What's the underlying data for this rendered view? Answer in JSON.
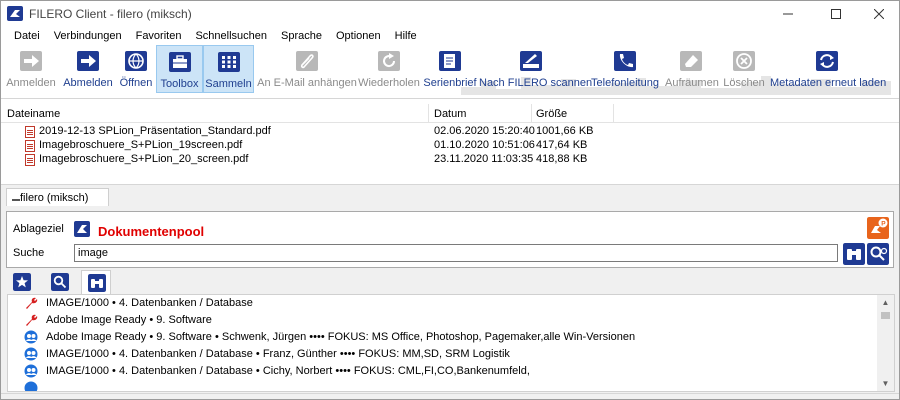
{
  "window": {
    "title": "FILERO Client  -  filero (miksch)"
  },
  "menu": [
    "Datei",
    "Verbindungen",
    "Favoriten",
    "Schnellsuchen",
    "Sprache",
    "Optionen",
    "Hilfe"
  ],
  "toolbar": [
    {
      "label": "Anmelden",
      "icon": "login-icon",
      "disabled": true
    },
    {
      "label": "Abmelden",
      "icon": "logout-icon",
      "disabled": false
    },
    {
      "label": "Öffnen",
      "icon": "globe-icon",
      "disabled": false
    },
    {
      "label": "Toolbox",
      "icon": "toolbox-icon",
      "disabled": false,
      "selected": true
    },
    {
      "label": "Sammeln",
      "icon": "grid-icon",
      "disabled": false,
      "selected": true
    },
    {
      "label": "An E-Mail anhängen",
      "icon": "email-attach-icon",
      "disabled": true
    },
    {
      "label": "Wiederholen",
      "icon": "repeat-icon",
      "disabled": true
    },
    {
      "label": "Serienbrief",
      "icon": "letter-icon",
      "disabled": false
    },
    {
      "label": "Nach FILERO scannen",
      "icon": "scanner-icon",
      "disabled": false
    },
    {
      "label": "Telefonleitung",
      "icon": "phone-icon",
      "disabled": false
    },
    {
      "label": "Aufräumen",
      "icon": "eraser-icon",
      "disabled": true
    },
    {
      "label": "Löschen",
      "icon": "delete-icon",
      "disabled": true
    },
    {
      "label": "Metadaten erneut laden",
      "icon": "reload-icon",
      "disabled": false
    }
  ],
  "files": {
    "headers": {
      "name": "Dateiname",
      "date": "Datum",
      "size": "Größe"
    },
    "rows": [
      {
        "name": "2019-12-13 SPLion_Präsentation_Standard.pdf",
        "date": "02.06.2020 15:20:40",
        "size": "1001,66 KB"
      },
      {
        "name": "Imagebroschuere_S+PLion_19screen.pdf",
        "date": "01.10.2020 10:51:06",
        "size": "417,64 KB"
      },
      {
        "name": "Imagebroschuere_S+PLion_20_screen.pdf",
        "date": "23.11.2020 11:03:35",
        "size": "418,88 KB"
      }
    ]
  },
  "tab": {
    "label": "filero (miksch)"
  },
  "search_panel": {
    "ablage_label": "Ablageziel",
    "ablage_value": "Dokumentenpool",
    "search_label": "Suche",
    "search_value": "image"
  },
  "results": [
    {
      "icon": "wrench-icon",
      "text": "IMAGE/1000 •  4. Datenbanken / Database"
    },
    {
      "icon": "wrench-icon",
      "text": "Adobe Image Ready •  9. Software"
    },
    {
      "icon": "contact-icon",
      "text": "Adobe Image Ready •  9. Software • Schwenk, Jürgen •••• FOKUS: MS Office, Photoshop, Pagemaker,alle Win-Versionen"
    },
    {
      "icon": "contact-icon",
      "text": "IMAGE/1000 •  4. Datenbanken / Database • Franz, Günther •••• FOKUS: MM,SD, SRM Logistik"
    },
    {
      "icon": "contact-icon",
      "text": "IMAGE/1000 •  4. Datenbanken / Database • Cichy, Norbert •••• FOKUS: CML,FI,CO,Bankenumfeld,"
    }
  ],
  "colors": {
    "accent": "#1f3a93",
    "red": "#e00000",
    "orange": "#e8641c",
    "selected": "#cce4f7"
  }
}
